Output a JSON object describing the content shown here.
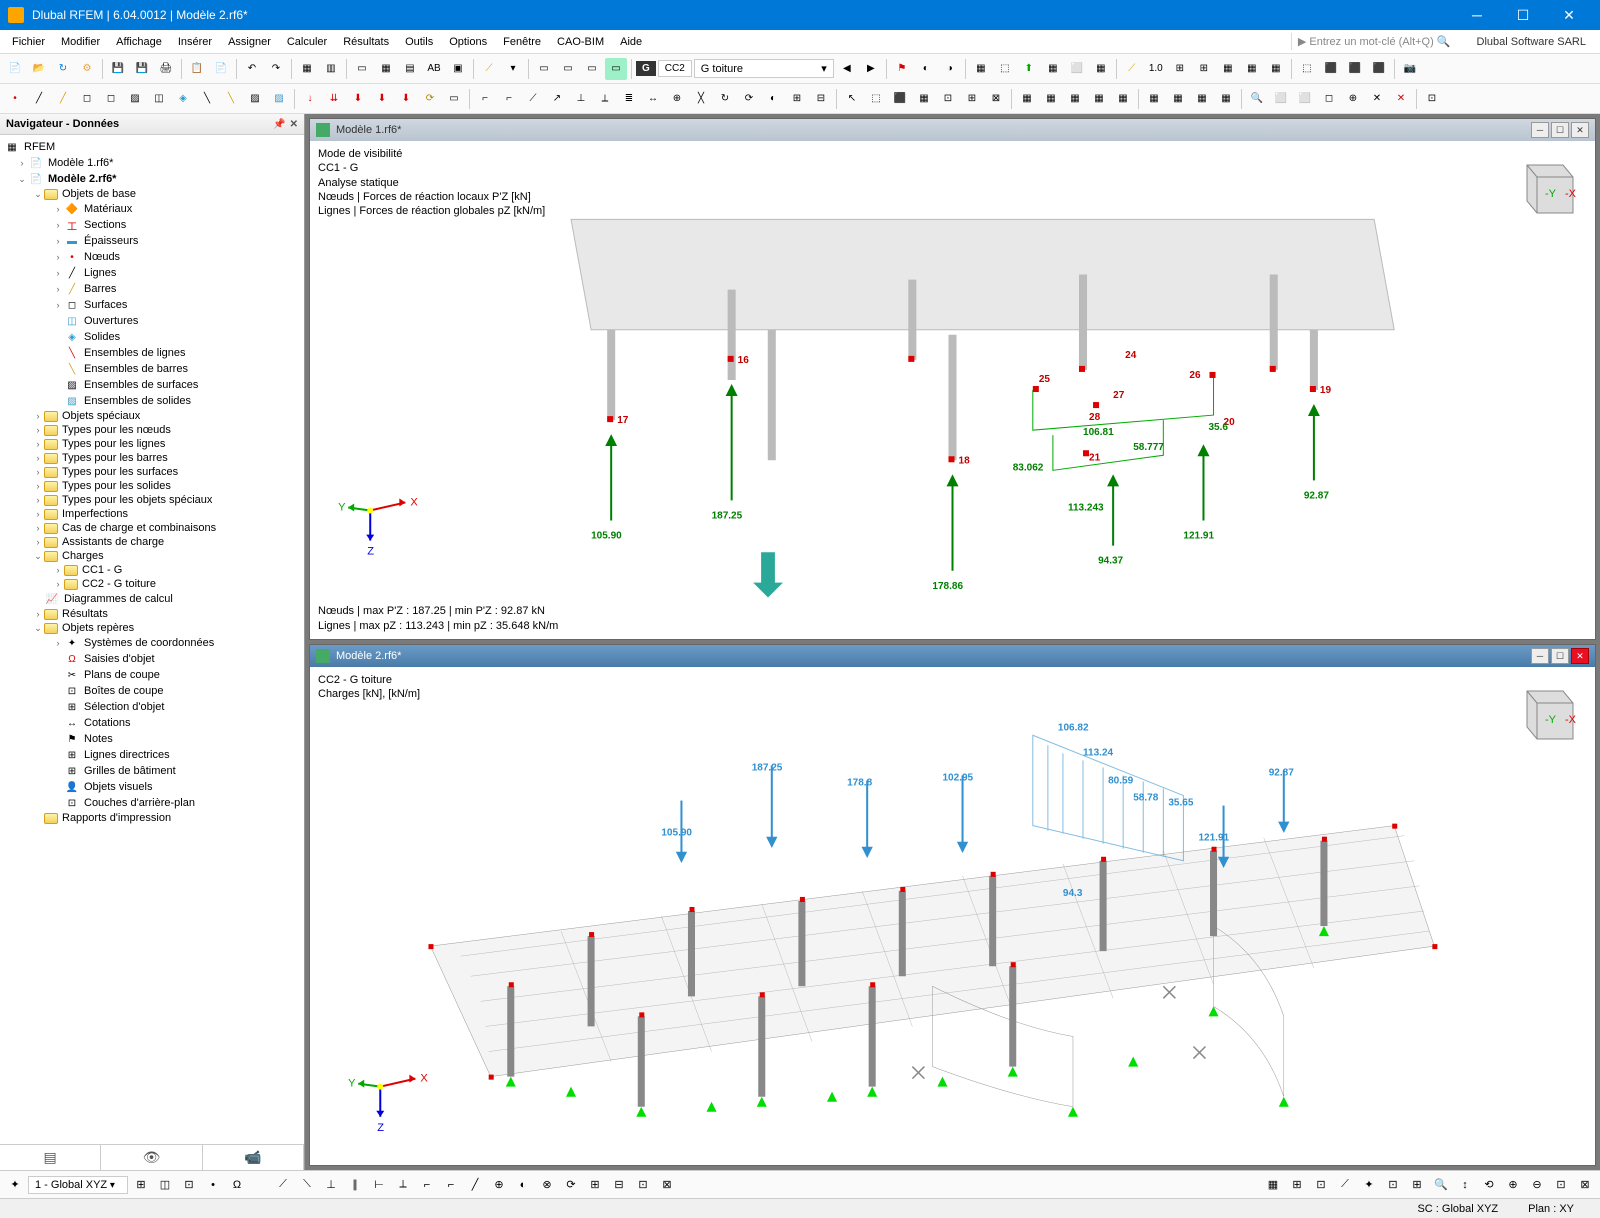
{
  "window": {
    "title": "Dlubal RFEM | 6.04.0012 | Modèle 2.rf6*",
    "brand": "Dlubal Software SARL"
  },
  "menu": [
    "Fichier",
    "Modifier",
    "Affichage",
    "Insérer",
    "Assigner",
    "Calculer",
    "Résultats",
    "Outils",
    "Options",
    "Fenêtre",
    "CAO-BIM",
    "Aide"
  ],
  "search_placeholder": "Entrez un mot-clé (Alt+Q)",
  "toolbar2": {
    "badge": "G",
    "case_code": "CC2",
    "case_name": "G toiture"
  },
  "navigator": {
    "title": "Navigateur - Données",
    "root": "RFEM",
    "model1": "Modèle 1.rf6*",
    "model2": "Modèle 2.rf6*",
    "base_objects": "Objets de base",
    "base_items": [
      "Matériaux",
      "Sections",
      "Épaisseurs",
      "Nœuds",
      "Lignes",
      "Barres",
      "Surfaces",
      "Ouvertures",
      "Solides",
      "Ensembles de lignes",
      "Ensembles de barres",
      "Ensembles de surfaces",
      "Ensembles de solides"
    ],
    "folders": [
      "Objets spéciaux",
      "Types pour les nœuds",
      "Types pour les lignes",
      "Types pour les barres",
      "Types pour les surfaces",
      "Types pour les solides",
      "Types pour les objets spéciaux",
      "Imperfections",
      "Cas de charge et combinaisons",
      "Assistants de charge"
    ],
    "charges": "Charges",
    "charge_items": [
      "CC1 - G",
      "CC2 - G toiture"
    ],
    "diag": "Diagrammes de calcul",
    "resultats": "Résultats",
    "objets_reperes": "Objets repères",
    "repere_items": [
      "Systèmes de coordonnées",
      "Saisies d'objet",
      "Plans de coupe",
      "Boîtes de coupe",
      "Sélection d'objet",
      "Cotations",
      "Notes",
      "Lignes directrices",
      "Grilles de bâtiment",
      "Objets visuels",
      "Couches d'arrière-plan"
    ],
    "rapports": "Rapports d'impression"
  },
  "view1": {
    "title": "Modèle 1.rf6*",
    "lines": [
      "Mode de visibilité",
      "CC1 - G",
      "Analyse statique",
      "Nœuds | Forces de réaction locaux P'Z [kN]",
      "Lignes | Forces de réaction globales pZ [kN/m]"
    ],
    "summary1": "Nœuds | max P'Z : 187.25 | min P'Z : 92.87 kN",
    "summary2": "Lignes | max pZ : 113.243 | min pZ : 35.648 kN/m",
    "nodes": {
      "16": "16",
      "17": "17",
      "18": "18",
      "19": "19",
      "20": "20",
      "21": "21",
      "24": "24",
      "25": "25",
      "26": "26",
      "27": "27",
      "28": "28"
    },
    "forces": {
      "f1": "105.90",
      "f2": "187.25",
      "f3": "178.86",
      "f4": "92.87",
      "f5": "121.91",
      "f6": "94.37",
      "f7": "113.243",
      "f8": "83.062",
      "f9": "106.81",
      "f10": "58.777",
      "f11": "35.6"
    }
  },
  "view2": {
    "title": "Modèle 2.rf6*",
    "lines": [
      "CC2 - G toiture",
      "Charges [kN], [kN/m]"
    ],
    "loads": {
      "l1": "105.90",
      "l2": "187.25",
      "l3": "178.8",
      "l4": "102.95",
      "l5": "92.87",
      "l6": "121.91",
      "l7": "106.82",
      "l8": "113.24",
      "l9": "80.59",
      "l10": "58.78",
      "l11": "35.65",
      "l12": "94.3"
    }
  },
  "cube_labels": {
    "y": "-Y",
    "x": "-X"
  },
  "axis_labels": {
    "x": "X",
    "y": "Y",
    "z": "Z"
  },
  "status": {
    "sc": "SC : Global XYZ",
    "plan": "Plan : XY"
  },
  "bottom_combo": "1 - Global XYZ"
}
